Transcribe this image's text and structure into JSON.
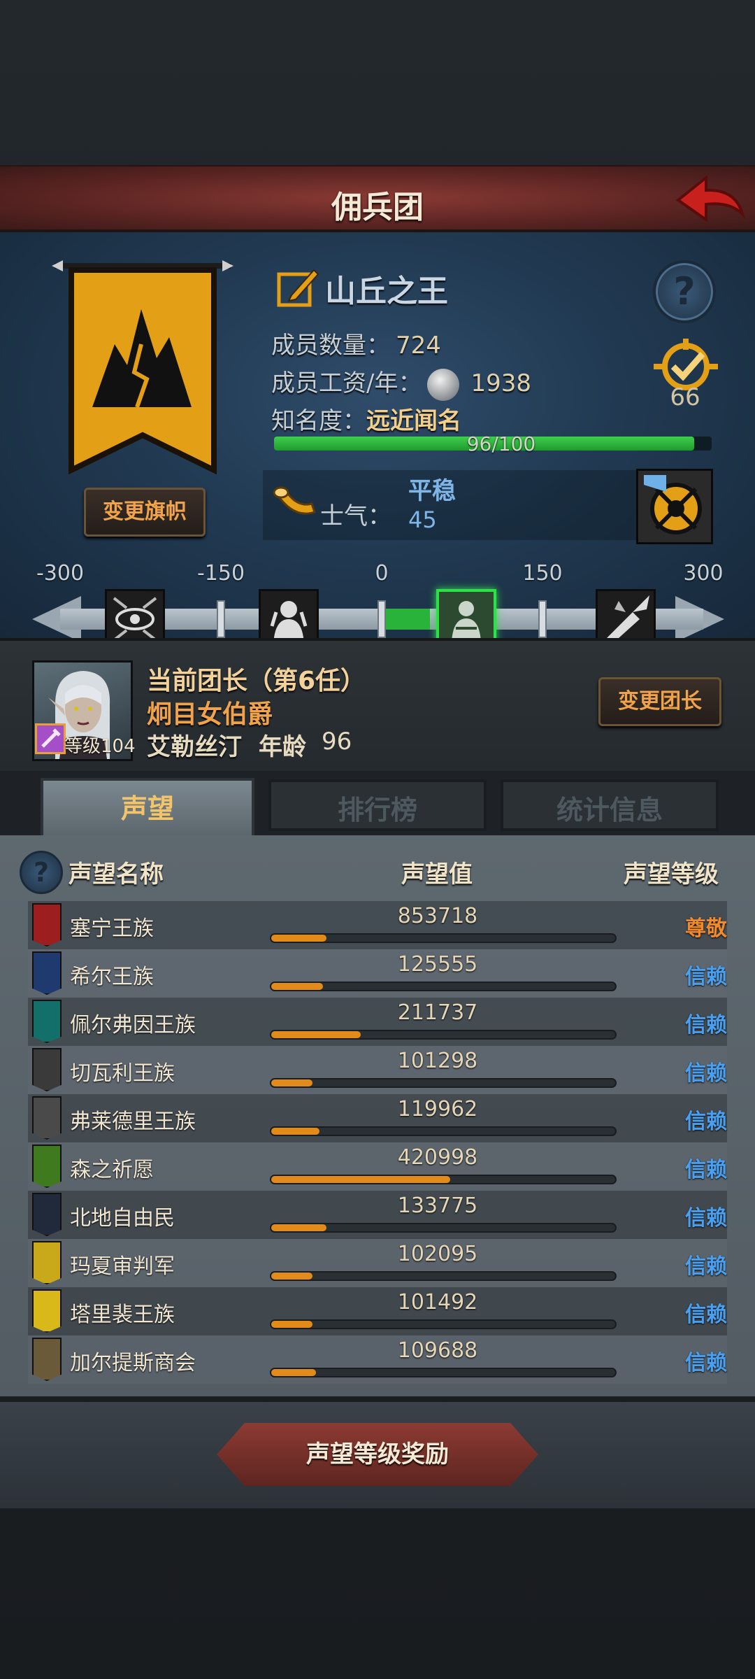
{
  "header": {
    "title": "佣兵团"
  },
  "guild": {
    "name": "山丘之王",
    "member_count_label": "成员数量：",
    "member_count": "724",
    "salary_label": "成员工资/年：",
    "salary": "1938",
    "fame_label": "知名度：",
    "fame_value": "远近闻名",
    "fame_progress_text": "96/100",
    "fame_progress": 0.96,
    "rank_number": "66",
    "change_flag_label": "变更旗帜",
    "colors": {
      "banner": "#e3a016",
      "fame_bar": "#2bb83b"
    }
  },
  "morale": {
    "label": "士气：",
    "state": "平稳",
    "value": "45",
    "scale_labels": [
      "-300",
      "-150",
      "0",
      "150",
      "300"
    ],
    "scale_min": -300,
    "scale_max": 300,
    "current": 45,
    "icons": [
      "eye-curse-icon",
      "despair-icon",
      "calm-icon",
      "battle-icon"
    ]
  },
  "leader": {
    "title": "当前团长（第6任）",
    "rank": "炯目女伯爵",
    "name": "艾勒丝汀",
    "age_label": "年龄",
    "age": "96",
    "level_label": "等级104",
    "change_leader_label": "变更团长"
  },
  "tabs": [
    {
      "label": "声望",
      "active": true
    },
    {
      "label": "排行榜",
      "active": false
    },
    {
      "label": "统计信息",
      "active": false
    }
  ],
  "reputation": {
    "headers": {
      "name": "声望名称",
      "value": "声望值",
      "level": "声望等级"
    },
    "rows": [
      {
        "name": "塞宁王族",
        "value": "853718",
        "fill": 0.16,
        "level": "尊敬",
        "tier": "revered",
        "icon_color": "#9c1e1e"
      },
      {
        "name": "希尔王族",
        "value": "125555",
        "fill": 0.15,
        "level": "信赖",
        "tier": "trusted",
        "icon_color": "#1e3a6e"
      },
      {
        "name": "佩尔弗因王族",
        "value": "211737",
        "fill": 0.26,
        "level": "信赖",
        "tier": "trusted",
        "icon_color": "#136f6a"
      },
      {
        "name": "切瓦利王族",
        "value": "101298",
        "fill": 0.12,
        "level": "信赖",
        "tier": "trusted",
        "icon_color": "#3a3a3a"
      },
      {
        "name": "弗莱德里王族",
        "value": "119962",
        "fill": 0.14,
        "level": "信赖",
        "tier": "trusted",
        "icon_color": "#4a4a4a"
      },
      {
        "name": "森之祈愿",
        "value": "420998",
        "fill": 0.52,
        "level": "信赖",
        "tier": "trusted",
        "icon_color": "#3f7a1e"
      },
      {
        "name": "北地自由民",
        "value": "133775",
        "fill": 0.16,
        "level": "信赖",
        "tier": "trusted",
        "icon_color": "#202a3a"
      },
      {
        "name": "玛夏审判军",
        "value": "102095",
        "fill": 0.12,
        "level": "信赖",
        "tier": "trusted",
        "icon_color": "#c9a81a"
      },
      {
        "name": "塔里裴王族",
        "value": "101492",
        "fill": 0.12,
        "level": "信赖",
        "tier": "trusted",
        "icon_color": "#d9b81a"
      },
      {
        "name": "加尔提斯商会",
        "value": "109688",
        "fill": 0.13,
        "level": "信赖",
        "tier": "trusted",
        "icon_color": "#6a5a3a"
      }
    ]
  },
  "bottom": {
    "reward_label": "声望等级奖励"
  }
}
